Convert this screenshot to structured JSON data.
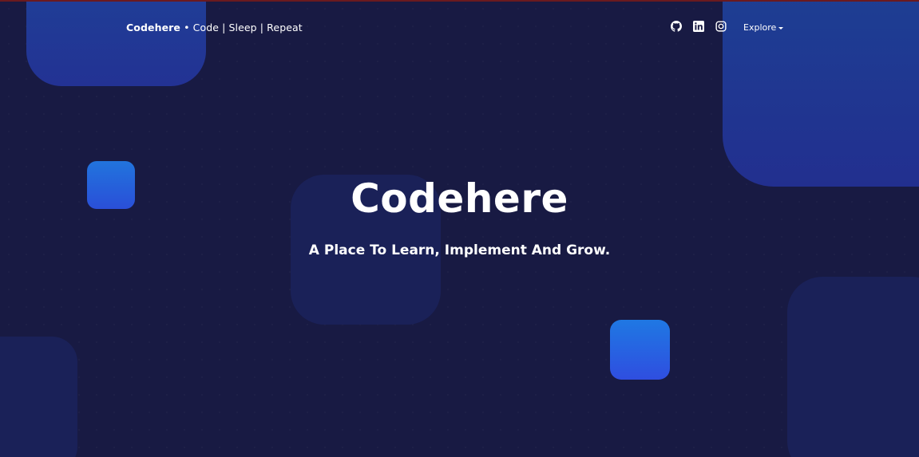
{
  "navbar": {
    "brand_name": "Codehere",
    "brand_tagline": " • Code | Sleep | Repeat",
    "explore_label": "Explore",
    "social_icons": [
      "github-icon",
      "linkedin-icon",
      "instagram-icon"
    ]
  },
  "hero": {
    "title": "Codehere",
    "subtitle": "A Place To Learn, Implement And Grow."
  },
  "colors": {
    "background": "#181a43",
    "shape_blue": "#2a4fd8",
    "shape_dark": "#1a2158",
    "text": "#ffffff",
    "top_border": "#6b1a1f"
  }
}
